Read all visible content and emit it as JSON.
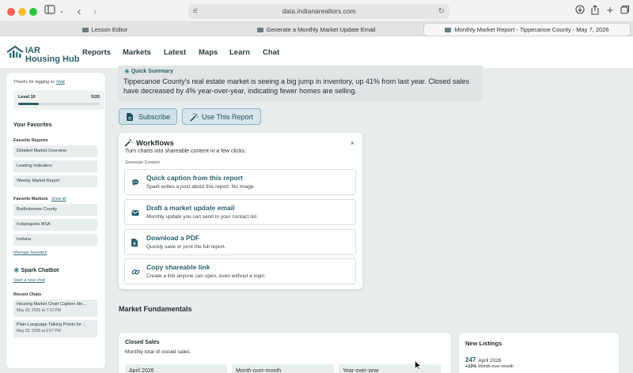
{
  "browser": {
    "url": "data.indianarealtors.com",
    "tabs": [
      {
        "label": "Lesson Editor"
      },
      {
        "label": "Generate a Monthly Market Update Email"
      },
      {
        "label": "Monthly Market Report - Tippecanoe County - May 7, 2026"
      }
    ]
  },
  "header": {
    "logo_text_1": "IAR",
    "logo_text_2": "Housing Hub",
    "nav": [
      "Reports",
      "Markets",
      "Latest",
      "Maps",
      "Learn",
      "Chat"
    ]
  },
  "sidebar": {
    "thanks_prefix": "Thanks for logging in,",
    "user": "Matt",
    "level_label": "Level 10",
    "level_count": "5/20",
    "level_progress": 0.25,
    "favorites_heading": "Your Favorites",
    "favorite_reports_label": "Favorite Reports",
    "favorite_reports": [
      "Detailed Market Overview",
      "Leading Indicators",
      "Weekly Market Report"
    ],
    "favorite_markets_label": "Favorite Markets",
    "show_all": "Show all",
    "favorite_markets": [
      "Bartholomew County",
      "Indianapolis MSA",
      "Indiana"
    ],
    "manage_favorites": "Manage favorites",
    "chatbot_heading": "Spark Chatbot",
    "new_chat": "Start a new chat",
    "recent_chats_label": "Recent Chats",
    "recent_chats": [
      {
        "title": "Housing Market Chart Caption Ide...",
        "date": "May 20, 2026 at 7:10 PM"
      },
      {
        "title": "Plain-Language Talking Points for ...",
        "date": "May 20, 2026 at 6:57 PM"
      }
    ]
  },
  "summary": {
    "title": "Quick Summary",
    "text": "Tippecanoe County's real estate market is seeing a big jump in inventory, up 41% from last year. Closed sales have decreased by 4% year-over-year, indicating fewer homes are selling."
  },
  "actions": {
    "subscribe": "Subscribe",
    "use_report": "Use This Report"
  },
  "workflows": {
    "title": "Workflows",
    "subtitle": "Turn charts into shareable content in a few clicks.",
    "section_label": "Generate Content",
    "close": "×",
    "options": [
      {
        "title": "Quick caption from this report",
        "desc": "Spark writes a post about this report. No image."
      },
      {
        "title": "Draft a market update email",
        "desc": "Monthly update you can send to your contact list."
      },
      {
        "title": "Download a PDF",
        "desc": "Quickly save or print the full report."
      },
      {
        "title": "Copy shareable link",
        "desc": "Create a link anyone can open, even without a login."
      }
    ]
  },
  "fundamentals": {
    "heading": "Market Fundamentals",
    "closed_sales": {
      "title": "Closed Sales",
      "subtitle": "Monthly total of closed sales",
      "columns": [
        "April 2026",
        "Month-over-month",
        "Year-over-year"
      ]
    },
    "new_listings": {
      "title": "New Listings",
      "value": "247",
      "period": "April 2026",
      "change": "+13%",
      "change_label": "Month-over-month"
    }
  }
}
